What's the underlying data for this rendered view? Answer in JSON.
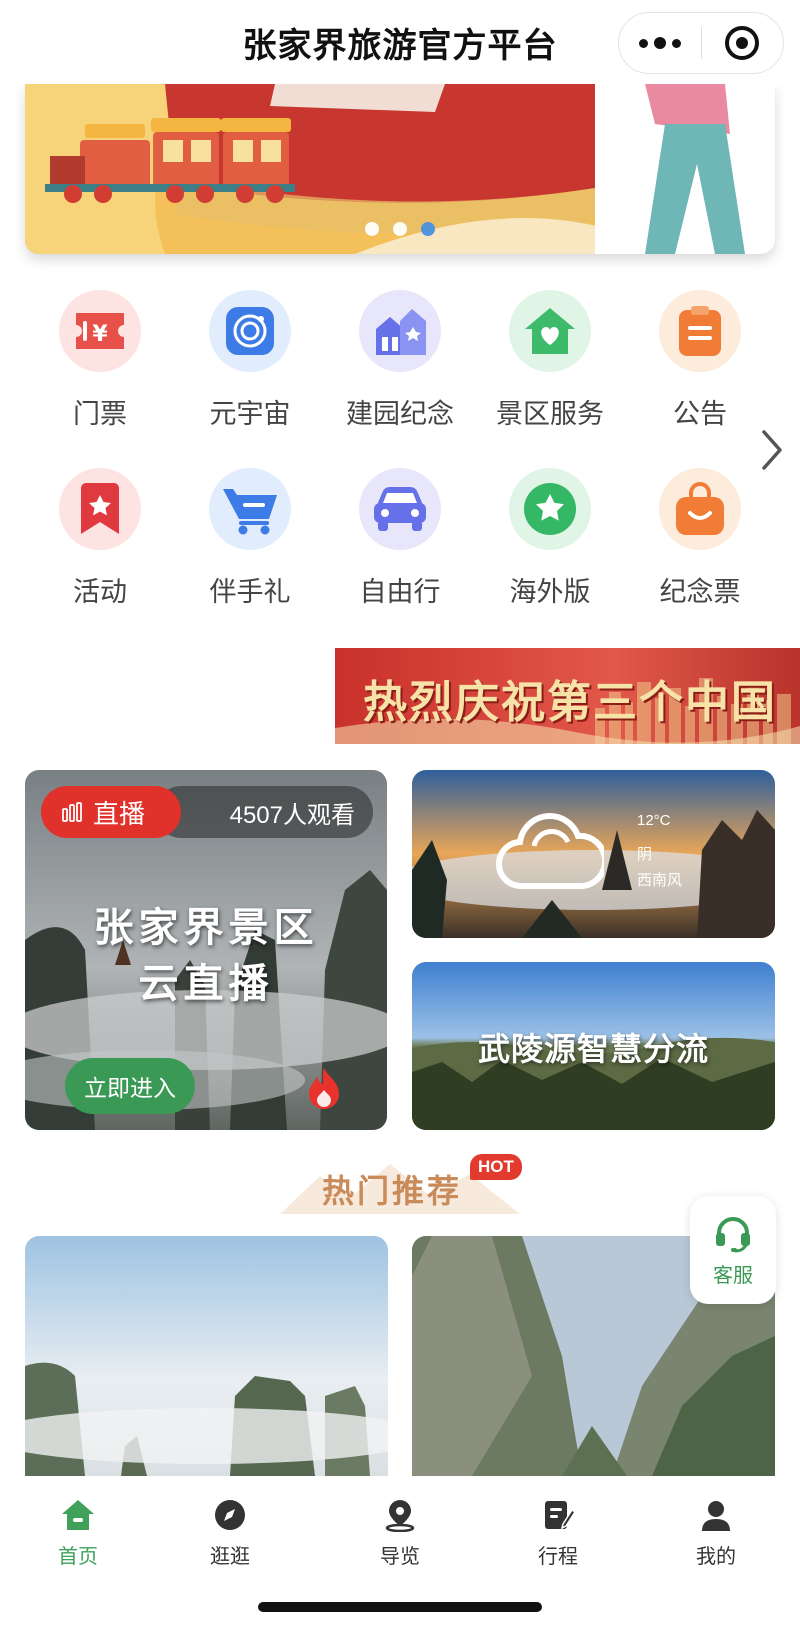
{
  "header": {
    "title": "张家界旅游官方平台"
  },
  "banner": {
    "slide_count": 3,
    "active_slide": 3
  },
  "grid": {
    "items": [
      {
        "label": "门票",
        "icon": "ticket-icon",
        "bg": "#fde3e1",
        "color": "#e8504a"
      },
      {
        "label": "元宇宙",
        "icon": "metaverse-icon",
        "bg": "#e1ecfd",
        "color": "#3d7be6"
      },
      {
        "label": "建园纪念",
        "icon": "building-icon",
        "bg": "#e7e6fb",
        "color": "#6670e8"
      },
      {
        "label": "景区服务",
        "icon": "home-heart-icon",
        "bg": "#e0f5e6",
        "color": "#3dbb6a"
      },
      {
        "label": "公告",
        "icon": "clipboard-icon",
        "bg": "#fdebdc",
        "color": "#f07c36"
      },
      {
        "label": "活动",
        "icon": "bookmark-star-icon",
        "bg": "#fde3e1",
        "color": "#e0393f"
      },
      {
        "label": "伴手礼",
        "icon": "cart-icon",
        "bg": "#e1ecfd",
        "color": "#3d7be6"
      },
      {
        "label": "自由行",
        "icon": "car-icon",
        "bg": "#e7e6fb",
        "color": "#6670e8"
      },
      {
        "label": "海外版",
        "icon": "star-badge-icon",
        "bg": "#e0f5e6",
        "color": "#34b866"
      },
      {
        "label": "纪念票",
        "icon": "shopping-bag-icon",
        "bg": "#fdebdc",
        "color": "#f07c36"
      }
    ]
  },
  "celebrate": {
    "text": "热烈庆祝第三个中国"
  },
  "live": {
    "badge": "直播",
    "viewers": "4507人观看",
    "title_line1": "张家界景区",
    "title_line2": "云直播",
    "enter_label": "立即进入"
  },
  "weather": {
    "temp": "12°C",
    "condition": "阴",
    "wind": "西南风"
  },
  "flow": {
    "title": "武陵源智慧分流"
  },
  "hot": {
    "title": "热门推荐",
    "badge": "HOT"
  },
  "service": {
    "label": "客服"
  },
  "tabbar": {
    "items": [
      {
        "label": "首页",
        "icon": "home-icon",
        "active": true
      },
      {
        "label": "逛逛",
        "icon": "compass-icon",
        "active": false
      },
      {
        "label": "导览",
        "icon": "map-pin-icon",
        "active": false
      },
      {
        "label": "行程",
        "icon": "itinerary-icon",
        "active": false
      },
      {
        "label": "我的",
        "icon": "user-icon",
        "active": false
      }
    ]
  },
  "colors": {
    "accent_green": "#3fa15a",
    "live_red": "#e0312b",
    "hot_red": "#e23b2e"
  }
}
